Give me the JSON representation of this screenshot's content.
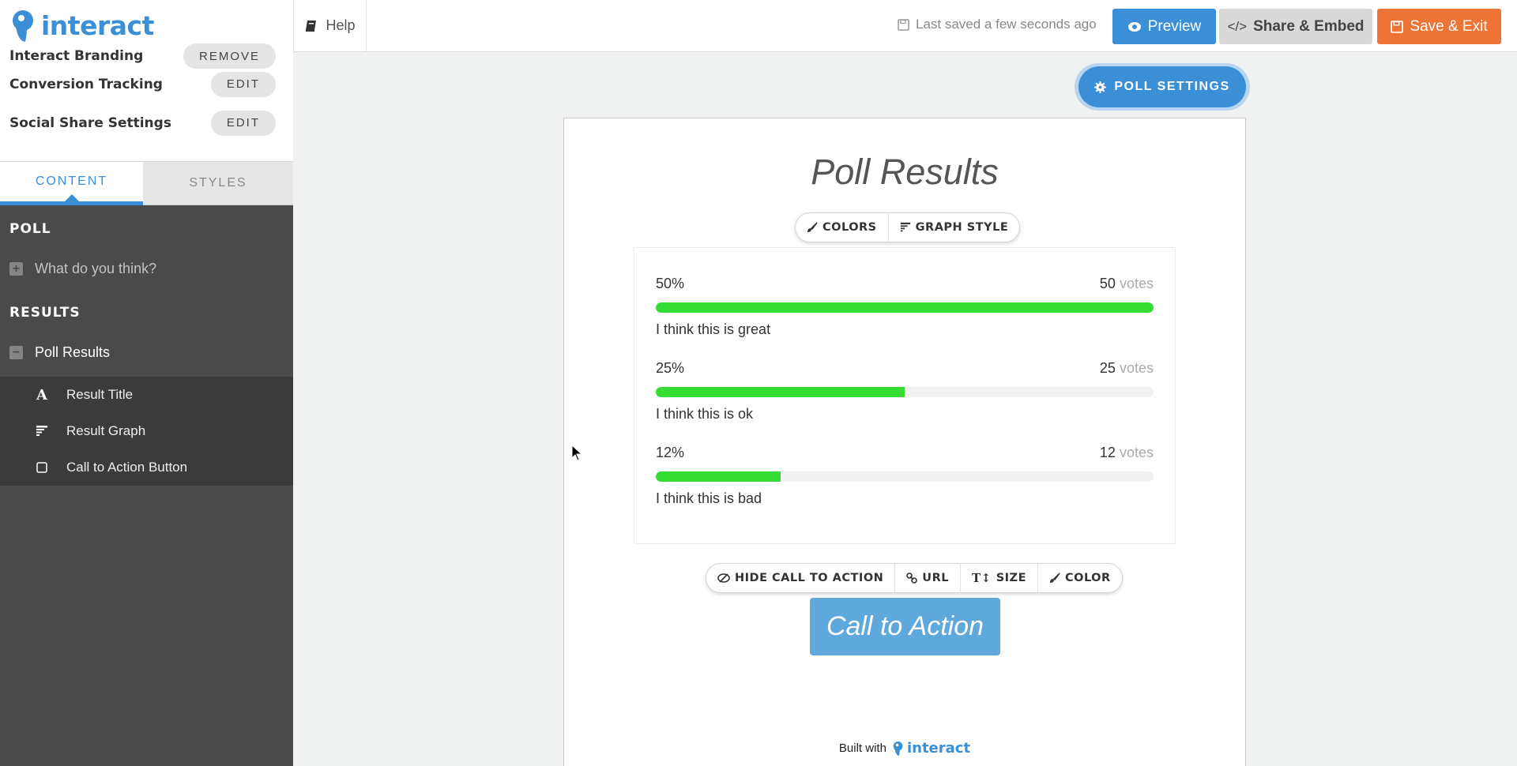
{
  "header": {
    "logo_text": "interact",
    "help_label": "Help",
    "saved_status": "Last saved a few seconds ago",
    "preview_label": "Preview",
    "share_label": "Share & Embed",
    "save_exit_label": "Save & Exit",
    "colors": {
      "brand": "#3a8fd6",
      "save": "#ed7434",
      "share": "#d9d9d9"
    }
  },
  "sidebar": {
    "settings": [
      {
        "label": "Interact Branding",
        "action": "REMOVE"
      },
      {
        "label": "Conversion Tracking",
        "action": "EDIT"
      },
      {
        "label": "Social Share Settings",
        "action": "EDIT"
      }
    ],
    "tabs": [
      {
        "label": "CONTENT",
        "active": true
      },
      {
        "label": "STYLES",
        "active": false
      }
    ],
    "sections": [
      {
        "title": "POLL",
        "items": [
          {
            "label": "What do you think?",
            "expander": "+"
          }
        ]
      },
      {
        "title": "RESULTS",
        "items": [
          {
            "label": "Poll Results",
            "expander": "−"
          }
        ]
      }
    ],
    "result_subitems": [
      {
        "label": "Result Title",
        "icon": "text-icon"
      },
      {
        "label": "Result Graph",
        "icon": "graph-icon"
      },
      {
        "label": "Call to Action Button",
        "icon": "button-icon"
      }
    ]
  },
  "canvas": {
    "poll_settings_label": "POLL SETTINGS",
    "title": "Poll Results",
    "graph_toolbar": {
      "colors": "COLORS",
      "graph_style": "GRAPH STYLE"
    },
    "results": [
      {
        "percent": "50%",
        "votes": "50",
        "votes_word": "votes",
        "label": "I think this is great",
        "fill": 1.0
      },
      {
        "percent": "25%",
        "votes": "25",
        "votes_word": "votes",
        "label": "I think this is ok",
        "fill": 0.5
      },
      {
        "percent": "12%",
        "votes": "12",
        "votes_word": "votes",
        "label": "I think this is bad",
        "fill": 0.25
      }
    ],
    "bar_color": "#35dd33",
    "cta_toolbar": {
      "hide": "HIDE CALL TO ACTION",
      "url": "URL",
      "size": "SIZE",
      "color": "COLOR"
    },
    "cta_label": "Call to Action",
    "built_with": "Built with",
    "built_logo": "interact"
  }
}
